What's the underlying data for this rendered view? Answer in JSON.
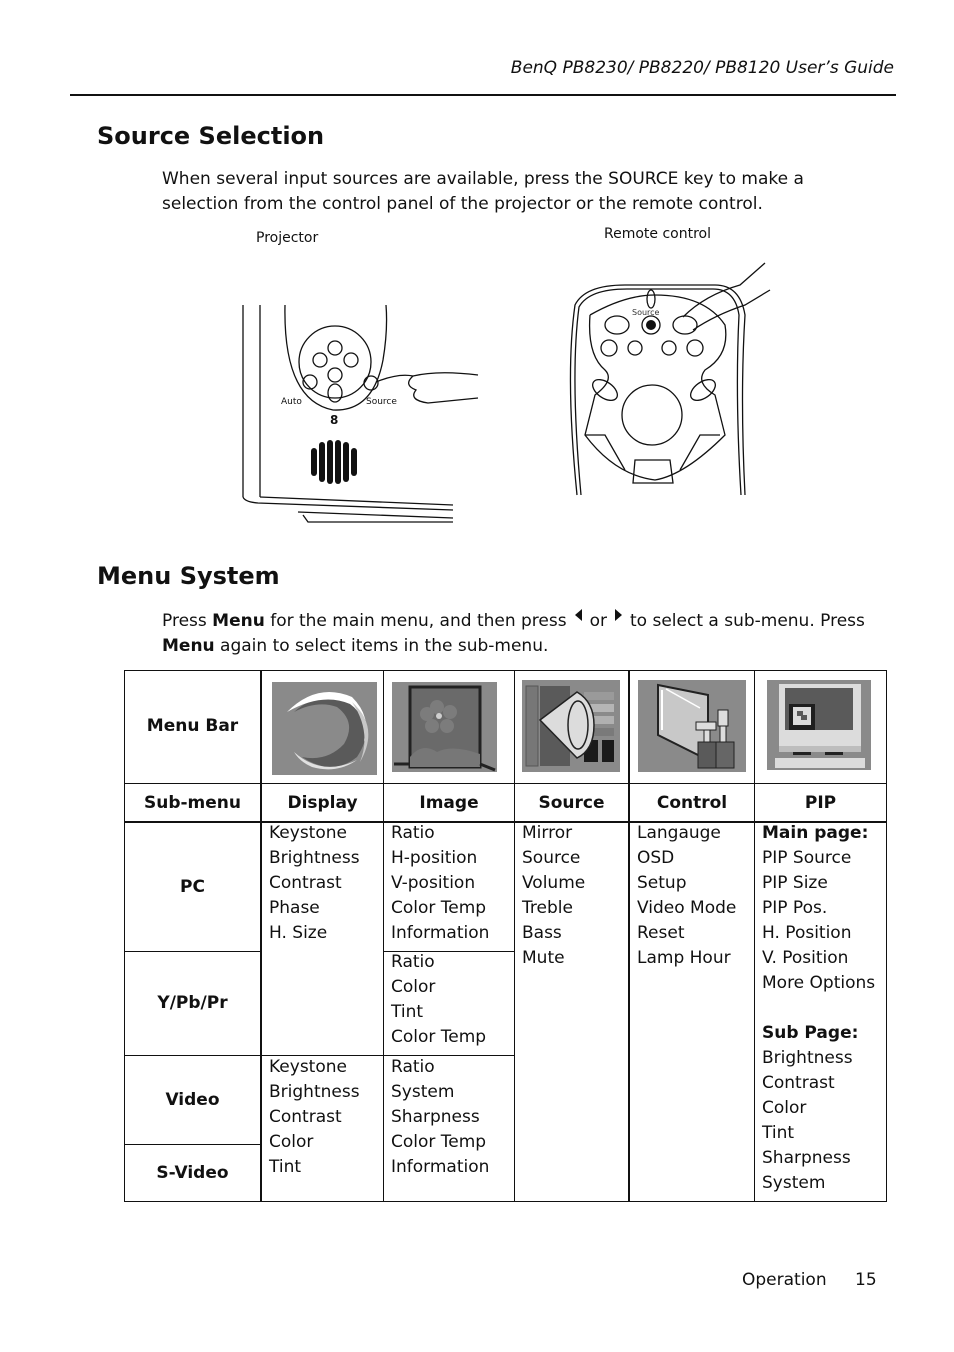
{
  "header": {
    "title": "BenQ PB8230/ PB8220/ PB8120 User’s Guide"
  },
  "source_selection": {
    "heading": "Source Selection",
    "paragraph": "When several input sources are available, press the SOURCE key to make a selection from the control panel of the projector or the remote control.",
    "figure_projector": {
      "caption": "Projector",
      "auto_label": "Auto",
      "source_label": "Source"
    },
    "figure_remote": {
      "caption": "Remote control",
      "source_label": "Source"
    }
  },
  "menu_system": {
    "heading": "Menu System",
    "instruction": {
      "part1": "Press ",
      "bold1": "Menu",
      "part2": " for the main menu, and then press",
      "or": "or",
      "part3": "to  select a sub-menu. Press",
      "bold2": "Menu",
      "part4": " again to select items in the sub-menu.",
      "left_icon": "left-arrow-icon",
      "right_icon": "right-arrow-icon"
    },
    "table": {
      "row_labels": {
        "menu_bar": "Menu Bar",
        "sub_menu": "Sub-menu",
        "pc": "PC",
        "ypbpr": "Y/Pb/Pr",
        "video": "Video",
        "svideo": "S-Video"
      },
      "columns": [
        {
          "name": "Display",
          "icon": "display-menu-icon"
        },
        {
          "name": "Image",
          "icon": "image-menu-icon"
        },
        {
          "name": "Source",
          "icon": "source-menu-icon"
        },
        {
          "name": "Control",
          "icon": "control-menu-icon"
        },
        {
          "name": "PIP",
          "icon": "pip-menu-icon"
        }
      ],
      "display": {
        "pc_ypbpr": [
          "Keystone",
          "Brightness",
          "Contrast",
          "Phase",
          "H. Size"
        ],
        "video_svideo": [
          "Keystone",
          "Brightness",
          "Contrast",
          "Color",
          "Tint"
        ]
      },
      "image": {
        "pc": [
          "Ratio",
          "H-position",
          "V-position",
          "Color Temp",
          "Information"
        ],
        "ypbpr": [
          "Ratio",
          "Color",
          "Tint",
          "Color Temp"
        ],
        "video_svideo": [
          "Ratio",
          "System",
          "Sharpness",
          "Color Temp",
          "Information"
        ]
      },
      "source": [
        "Mirror",
        "Source",
        "Volume",
        "Treble",
        "Bass",
        "Mute"
      ],
      "control": [
        "Langauge",
        "OSD",
        "Setup",
        "Video Mode",
        "Reset",
        "Lamp Hour"
      ],
      "pip": {
        "main_heading": "Main page:",
        "main_items": [
          "PIP Source",
          "PIP Size",
          "PIP Pos.",
          "H. Position",
          "V. Position",
          "More Options"
        ],
        "sub_heading": "Sub Page:",
        "sub_items": [
          "Brightness",
          "Contrast",
          "Color",
          "Tint",
          "Sharpness",
          "System"
        ]
      }
    }
  },
  "footer": {
    "section": "Operation",
    "page": "15"
  }
}
